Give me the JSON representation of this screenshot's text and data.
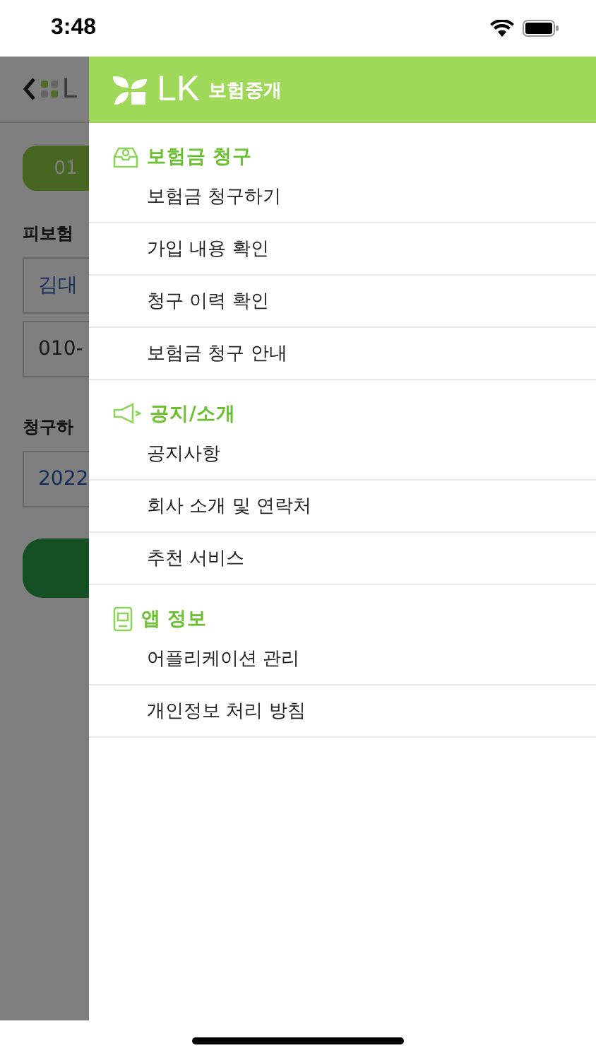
{
  "status_bar": {
    "time": "3:48"
  },
  "background": {
    "logo_text": "L",
    "step": "01",
    "insured_label": "피보험",
    "name_value": "김대",
    "phone_value": "010-",
    "claim_label": "청구하",
    "date_value": "2022"
  },
  "drawer": {
    "brand": "LK",
    "brand_sub": "보험중개",
    "sections": [
      {
        "kind": "claim",
        "title": "보험금 청구",
        "items": [
          "보험금 청구하기",
          "가입 내용 확인",
          "청구 이력 확인",
          "보험금 청구 안내"
        ]
      },
      {
        "kind": "notice",
        "title": "공지/소개",
        "items": [
          "공지사항",
          "회사 소개 및 연락처",
          "추천 서비스"
        ]
      },
      {
        "kind": "app",
        "title": "앱 정보",
        "items": [
          "어플리케이션 관리",
          "개인정보 처리 방침"
        ]
      }
    ]
  }
}
